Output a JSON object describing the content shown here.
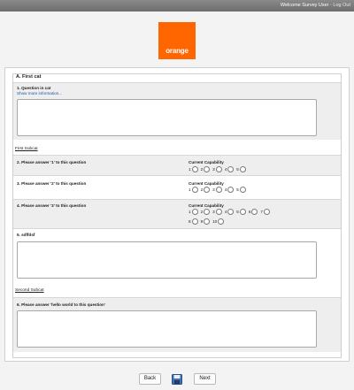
{
  "header": {
    "user_text": "Welcome Survey User",
    "separator": "-",
    "logout_label": "Log Out"
  },
  "brand": {
    "logo_text": "orange",
    "color": "#ff6600"
  },
  "category": {
    "title": "A. First cat"
  },
  "q1": {
    "label": "1. Question in cat",
    "more_link": "Show more information..."
  },
  "subcat1": {
    "title": "First Subcat"
  },
  "q2": {
    "label": "2. Please answer '1' to this question",
    "cap_label": "Current Capability",
    "options": [
      "1",
      "2",
      "3",
      "4",
      "5"
    ]
  },
  "q3": {
    "label": "3. Please answer '2' to this question",
    "cap_label": "Current Capability",
    "options": [
      "1",
      "2",
      "3",
      "4",
      "5"
    ]
  },
  "q4": {
    "label": "4. Please answer '3' to this question",
    "cap_label": "Current Capability",
    "options": [
      "1",
      "2",
      "3",
      "4",
      "5",
      "6",
      "7",
      "8",
      "9",
      "10"
    ]
  },
  "q5": {
    "label": "5. sdffdsf"
  },
  "subcat2": {
    "title": "Second Subcat"
  },
  "q6": {
    "label": "6. Please answer 'hello world to this question'"
  },
  "footer": {
    "back_label": "Back",
    "next_label": "Next",
    "save_icon": "floppy-disk-icon"
  }
}
